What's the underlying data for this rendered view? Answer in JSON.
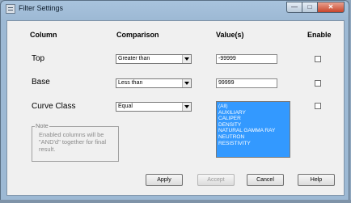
{
  "window": {
    "title": "Filter Settings",
    "minimize_symbol": "—",
    "maximize_symbol": "□",
    "close_symbol": "✕"
  },
  "headers": {
    "column": "Column",
    "comparison": "Comparison",
    "values": "Value(s)",
    "enable": "Enable"
  },
  "rows": [
    {
      "label": "Top",
      "comparison": "Greater than",
      "value": "-99999",
      "enabled": false
    },
    {
      "label": "Base",
      "comparison": "Less than",
      "value": "99999",
      "enabled": false
    },
    {
      "label": "Curve Class",
      "comparison": "Equal",
      "enabled": false,
      "options": [
        "(All)",
        "",
        "AUXILIARY",
        "CALIPER",
        "DENSITY",
        "NATURAL GAMMA RAY",
        "NEUTRON",
        "RESISTIVITY"
      ]
    }
  ],
  "note": {
    "legend": "Note",
    "text": "Enabled columns will be \"AND'd\" together for final result."
  },
  "buttons": {
    "apply": "Apply",
    "accept": "Accept",
    "cancel": "Cancel",
    "help": "Help"
  },
  "colors": {
    "selection": "#3399ff",
    "titlebar": "#a8c3dd"
  },
  "icons": {
    "title": "filter-settings-window-icon",
    "combo": "chevron-down-icon"
  }
}
